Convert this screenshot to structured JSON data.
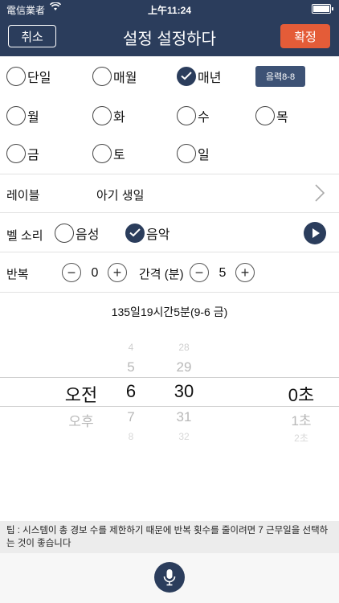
{
  "status_bar": {
    "carrier": "電信業者",
    "time": "上午11:24"
  },
  "nav": {
    "title": "설정 설정하다",
    "cancel_label": "취소",
    "confirm_label": "확정"
  },
  "mode": {
    "options": [
      {
        "label": "단일",
        "checked": false
      },
      {
        "label": "매월",
        "checked": false
      },
      {
        "label": "매년",
        "checked": true
      }
    ],
    "badge": "음력8-8"
  },
  "weekdays": [
    {
      "label": "월",
      "checked": false
    },
    {
      "label": "화",
      "checked": false
    },
    {
      "label": "수",
      "checked": false
    },
    {
      "label": "목",
      "checked": false
    },
    {
      "label": "금",
      "checked": false
    },
    {
      "label": "토",
      "checked": false
    },
    {
      "label": "일",
      "checked": false
    }
  ],
  "label_row": {
    "key": "레이블",
    "value": "아기 생일"
  },
  "bell_row": {
    "key": "벨 소리",
    "options": [
      {
        "label": "음성",
        "checked": false
      },
      {
        "label": "음악",
        "checked": true
      }
    ]
  },
  "repeat_row": {
    "key": "반복",
    "repeat_value": "0",
    "interval_label": "간격 (분)",
    "interval_value": "5",
    "minus": "−",
    "plus": "+"
  },
  "countdown": "135일19시간5분(9-6 금)",
  "picker": {
    "ampm": {
      "selected": "오전",
      "below": "오후"
    },
    "hour": {
      "above2": "4",
      "above1": "5",
      "selected": "6",
      "below1": "7",
      "below2": "8"
    },
    "minute": {
      "above2": "28",
      "above1": "29",
      "selected": "30",
      "below1": "31",
      "below2": "32"
    },
    "second": {
      "selected": "0초",
      "below1": "1초",
      "below2": "2초"
    }
  },
  "tip": "팁 : 시스템이 총 경보 수를 제한하기 때문에 반복 횟수를 줄이려면 7 근무일을 선택하는 것이 좋습니다"
}
